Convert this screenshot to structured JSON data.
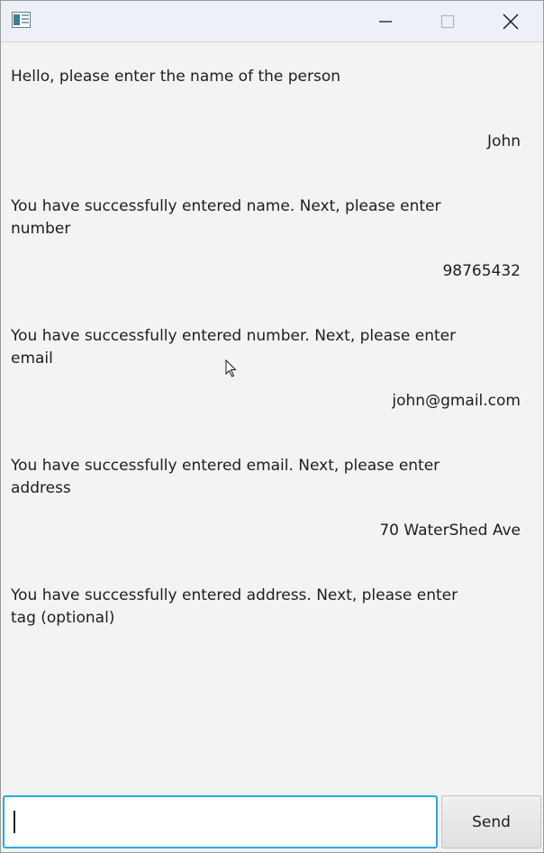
{
  "window": {
    "minimize_icon": "minimize-icon",
    "maximize_icon": "maximize-icon",
    "close_icon": "close-icon",
    "app_icon": "app-icon"
  },
  "chat": {
    "messages": [
      {
        "sender": "bot",
        "text": "Hello, please enter the name of the person"
      },
      {
        "sender": "user",
        "text": "John"
      },
      {
        "sender": "bot",
        "text": "You have successfully entered name. Next, please enter number"
      },
      {
        "sender": "user",
        "text": "98765432"
      },
      {
        "sender": "bot",
        "text": "You have successfully entered number. Next, please enter email"
      },
      {
        "sender": "user",
        "text": "john@gmail.com"
      },
      {
        "sender": "bot",
        "text": "You have successfully entered email. Next, please enter address"
      },
      {
        "sender": "user",
        "text": "70 WaterShed Ave"
      },
      {
        "sender": "bot",
        "text": "You have successfully entered address. Next, please enter tag (optional)"
      }
    ]
  },
  "input": {
    "value": "",
    "send_label": "Send"
  },
  "colors": {
    "focus_border": "#2aa8e0",
    "background": "#f3f3f3",
    "titlebar": "#eef0f8"
  }
}
